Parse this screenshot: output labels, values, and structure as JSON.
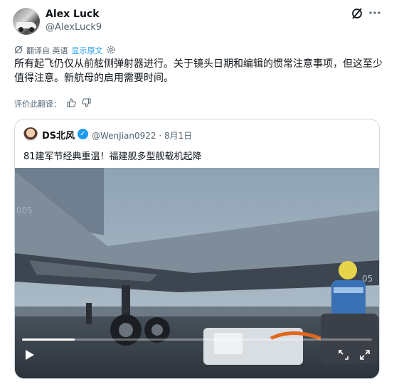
{
  "tweet": {
    "author_name": "Alex Luck",
    "author_handle": "@AlexLuck9",
    "translated_from": "翻译自 英语",
    "show_original": "显示原文",
    "text": "所有起飞仍仅从前舷侧弹射器进行。关于镜头日期和编辑的惯常注意事项，但这至少值得注意。新航母的启用需要时间。",
    "rate_translation": "评价此翻译："
  },
  "quoted": {
    "author_name": "DS北风",
    "author_handle": "@WenJian0922",
    "date": "· 8月1日",
    "text": "81建军节经典重温！福建舰多型舰载机起降",
    "aircraft_marking": "005",
    "aircraft_marking2": "05"
  },
  "video": {
    "progress": 0.15
  },
  "icons": [
    "grok-icon",
    "more-icon",
    "translate-icon",
    "settings-icon",
    "thumbs-up-icon",
    "thumbs-down-icon",
    "verified-icon",
    "play-icon",
    "expand-icon",
    "fullscreen-icon"
  ],
  "colors": {
    "accent": "#1d9bf0",
    "muted": "#536471",
    "text": "#0f1419"
  }
}
